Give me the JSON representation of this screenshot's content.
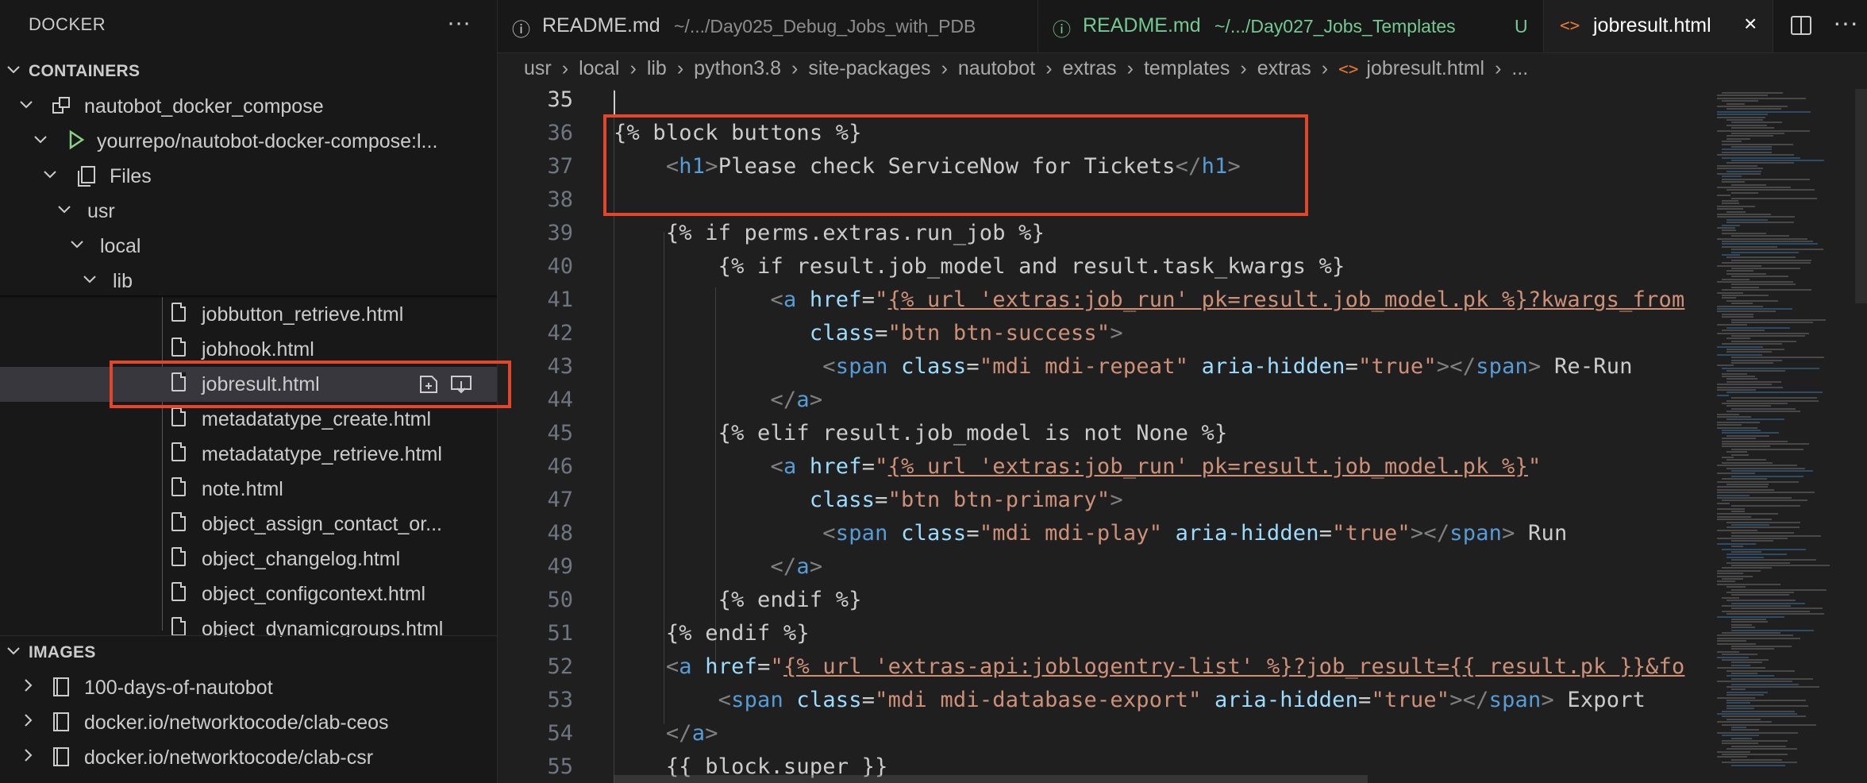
{
  "sidebar": {
    "title": "DOCKER",
    "more_glyph": "···",
    "containers_label": "CONTAINERS",
    "images_label": "IMAGES",
    "container_tree": [
      {
        "label": "nautobot_docker_compose"
      },
      {
        "label": "yourrepo/nautobot-docker-compose:l..."
      },
      {
        "label": "Files"
      },
      {
        "label": "usr"
      },
      {
        "label": "local"
      },
      {
        "label": "lib"
      }
    ],
    "files": [
      {
        "label": "jobbutton_retrieve.html"
      },
      {
        "label": "jobhook.html"
      },
      {
        "label": "jobresult.html"
      },
      {
        "label": "metadatatype_create.html"
      },
      {
        "label": "metadatatype_retrieve.html"
      },
      {
        "label": "note.html"
      },
      {
        "label": "object_assign_contact_or..."
      },
      {
        "label": "object_changelog.html"
      },
      {
        "label": "object_configcontext.html"
      },
      {
        "label": "object_dynamicgroups.html"
      }
    ],
    "images": [
      {
        "label": "100-days-of-nautobot"
      },
      {
        "label": "docker.io/networktocode/clab-ceos"
      },
      {
        "label": "docker.io/networktocode/clab-csr"
      }
    ]
  },
  "tabs": [
    {
      "name": "README.md",
      "path": "~/.../Day025_Debug_Jobs_with_PDB",
      "icon": "info-icon",
      "color": "#cccccc"
    },
    {
      "name": "README.md",
      "path": "~/.../Day027_Jobs_Templates",
      "badge": "U",
      "icon": "info-icon",
      "color": "#73c991"
    },
    {
      "name": "jobresult.html",
      "icon": "code-icon",
      "close": "×",
      "color": "#ffffff"
    }
  ],
  "breadcrumb": [
    "usr",
    "local",
    "lib",
    "python3.8",
    "site-packages",
    "nautobot",
    "extras",
    "templates",
    "extras",
    "jobresult.html",
    "..."
  ],
  "editor": {
    "line_numbers": [
      "35",
      "36",
      "37",
      "38",
      "39",
      "40",
      "41",
      "42",
      "43",
      "44",
      "45",
      "46",
      "47",
      "48",
      "49",
      "50",
      "51",
      "52",
      "53",
      "54",
      "55"
    ],
    "lines": [
      "",
      "{% block buttons %}",
      "    <h1>Please check ServiceNow for Tickets</h1>",
      "",
      "    {% if perms.extras.run_job %}",
      "        {% if result.job_model and result.task_kwargs %}",
      "            <a href=\"{% url 'extras:job_run' pk=result.job_model.pk %}?kwargs_from",
      "               class=\"btn btn-success\">",
      "                <span class=\"mdi mdi-repeat\" aria-hidden=\"true\"></span> Re-Run",
      "            </a>",
      "        {% elif result.job_model is not None %}",
      "            <a href=\"{% url 'extras:job_run' pk=result.job_model.pk %}\"",
      "               class=\"btn btn-primary\">",
      "                <span class=\"mdi mdi-play\" aria-hidden=\"true\"></span> Run",
      "            </a>",
      "        {% endif %}",
      "    {% endif %}",
      "    <a href=\"{% url 'extras-api:joblogentry-list' %}?job_result={{ result.pk }}&fo",
      "        <span class=\"mdi mdi-database-export\" aria-hidden=\"true\"></span> Export",
      "    </a>",
      "    {{ block.super }}"
    ]
  },
  "colors": {
    "highlight_box": "#e2472b",
    "tag": "#569cd6",
    "attribute": "#9cdcfe",
    "string": "#ce9178"
  }
}
